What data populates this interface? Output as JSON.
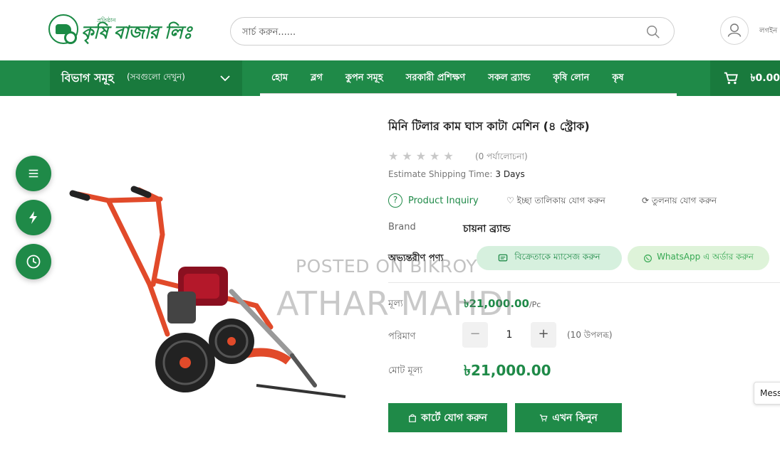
{
  "header": {
    "logo_small": "প্রতিষ্ঠান",
    "logo_text": "কৃষি বাজার লিঃ",
    "search_placeholder": "সার্চ করুন......",
    "login_label": "লগইন"
  },
  "nav": {
    "category_title": "বিভাগ সমূহ",
    "category_sub": "(সবগুলো দেখুন)",
    "menu": [
      "হোম",
      "ব্লগ",
      "কুপন সমূহ",
      "সরকারী প্রশিক্ষণ",
      "সকল ব্র্যান্ড",
      "কৃষি লোন",
      "কৃষ"
    ],
    "cart_amount": "৳0.00"
  },
  "product": {
    "title": "মিনি টিলার কাম ঘাস কাটা মেশিন (৪ স্ট্রোক)",
    "rating_stars": 0,
    "reviews": "(0 পর্যালোচনা)",
    "shipping_label": "Estimate Shipping Time:",
    "shipping_value": "3 Days",
    "inquiry": "Product Inquiry",
    "wishlist": "ইচ্ছা তালিকায় যোগ করুন",
    "compare": "তুলনায় যোগ করুন",
    "brand_label": "Brand",
    "brand_value": "চায়না ব্র্যান্ড",
    "local_label": "অভ্যন্তরীণ পণ্য",
    "message_seller": "বিক্রেতাকে ম্যাসেজ করুন",
    "whatsapp_order": "WhatsApp এ অর্ডার করুন",
    "price_label": "মূল্য",
    "price_value": "৳21,000.00",
    "price_unit": "/Pc",
    "qty_label": "পরিমাণ",
    "qty_minus": "−",
    "qty_value": "1",
    "qty_plus": "+",
    "available": "(10 উপলব্ধ)",
    "total_label": "মোট মূল্য",
    "total_value": "৳21,000.00",
    "add_to_cart": "কার্টে যোগ করুন",
    "buy_now": "এখন কিনুন"
  },
  "watermark": {
    "line1": "POSTED ON BIKROY",
    "line2": "ATHAR MAHDI"
  },
  "messenger_label": "Messenger",
  "colors": {
    "brand_green": "#1f8a48",
    "dark_green": "#197a3d",
    "machine_red": "#e14a2a"
  }
}
